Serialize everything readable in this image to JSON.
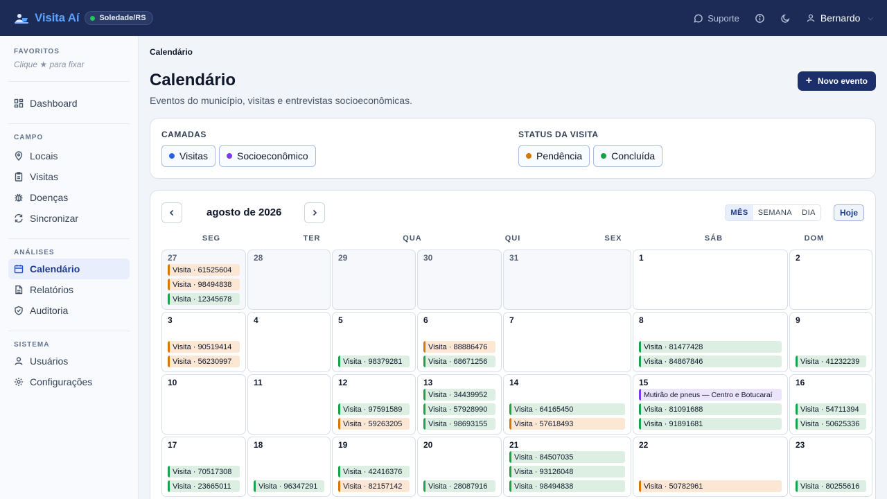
{
  "app": {
    "brand": "Visita Aí",
    "city": "Soledade/RS",
    "support": "Suporte",
    "user": "Bernardo"
  },
  "sidebar": {
    "favorites_title": "FAVORITOS",
    "favorites_hint": "Clique ★ para fixar",
    "dashboard": "Dashboard",
    "field_title": "CAMPO",
    "field_items": [
      "Locais",
      "Visitas",
      "Doenças",
      "Sincronizar"
    ],
    "analysis_title": "ANÁLISES",
    "analysis_items": [
      "Calendário",
      "Relatórios",
      "Auditoria"
    ],
    "system_title": "SISTEMA",
    "system_items": [
      "Usuários",
      "Configurações"
    ]
  },
  "page": {
    "breadcrumb": "Calendário",
    "title": "Calendário",
    "subtitle": "Eventos do município, visitas e entrevistas socioeconômicas.",
    "new_event": "Novo evento"
  },
  "filters": {
    "layers_title": "CAMADAS",
    "layers": [
      "Visitas",
      "Socioeconômico"
    ],
    "status_title": "STATUS DA VISITA",
    "status": [
      "Pendência",
      "Concluída"
    ],
    "colors": {
      "visitas": "#2563eb",
      "socio": "#7c3aed",
      "pendencia": "#d97706",
      "concluida": "#16a34a"
    }
  },
  "calendar": {
    "month": "agosto de 2026",
    "views": [
      "MÊS",
      "SEMANA",
      "DIA"
    ],
    "active_view": "MÊS",
    "today": "Hoje",
    "weekdays": [
      "SEG",
      "TER",
      "QUA",
      "QUI",
      "SEX",
      "SÁB",
      "DOM"
    ],
    "weeks": [
      [
        {
          "day": "27",
          "out": true,
          "events": [
            {
              "t": "Visita · 61525604",
              "s": "pend"
            },
            {
              "t": "Visita · 98494838",
              "s": "pend"
            },
            {
              "t": "Visita · 12345678",
              "s": "ok"
            }
          ]
        },
        {
          "day": "28",
          "out": true,
          "events": []
        },
        {
          "day": "29",
          "out": true,
          "events": []
        },
        {
          "day": "30",
          "out": true,
          "events": []
        },
        {
          "day": "31",
          "out": true,
          "events": []
        },
        {
          "day": "1",
          "events": []
        },
        {
          "day": "2",
          "events": []
        }
      ],
      [
        {
          "day": "3",
          "events": [
            {
              "t": "Visita · 90519414",
              "s": "pend"
            },
            {
              "t": "Visita · 56230997",
              "s": "pend"
            }
          ]
        },
        {
          "day": "4",
          "events": []
        },
        {
          "day": "5",
          "events": [
            {
              "t": "Visita · 98379281",
              "s": "ok"
            }
          ]
        },
        {
          "day": "6",
          "events": [
            {
              "t": "Visita · 88886476",
              "s": "pend"
            },
            {
              "t": "Visita · 68671256",
              "s": "ok"
            }
          ]
        },
        {
          "day": "7",
          "events": []
        },
        {
          "day": "8",
          "events": [
            {
              "t": "Visita · 81477428",
              "s": "ok"
            },
            {
              "t": "Visita · 84867846",
              "s": "ok"
            }
          ]
        },
        {
          "day": "9",
          "events": [
            {
              "t": "Visita · 41232239",
              "s": "ok"
            }
          ]
        }
      ],
      [
        {
          "day": "10",
          "events": []
        },
        {
          "day": "11",
          "events": []
        },
        {
          "day": "12",
          "events": [
            {
              "t": "Visita · 97591589",
              "s": "ok"
            },
            {
              "t": "Visita · 59263205",
              "s": "pend"
            }
          ]
        },
        {
          "day": "13",
          "events": [
            {
              "t": "Visita · 34439952",
              "s": "ok"
            },
            {
              "t": "Visita · 57928990",
              "s": "ok"
            },
            {
              "t": "Visita · 98693155",
              "s": "ok"
            }
          ]
        },
        {
          "day": "14",
          "events": [
            {
              "t": "Visita · 64165450",
              "s": "ok"
            },
            {
              "t": "Visita · 57618493",
              "s": "pend"
            }
          ]
        },
        {
          "day": "15",
          "events": [
            {
              "t": "Mutirão de pneus — Centro e Botucaraí",
              "s": "soc"
            },
            {
              "t": "Visita · 81091688",
              "s": "ok"
            },
            {
              "t": "Visita · 91891681",
              "s": "ok"
            }
          ]
        },
        {
          "day": "16",
          "events": [
            {
              "t": "Visita · 54711394",
              "s": "ok"
            },
            {
              "t": "Visita · 50625336",
              "s": "ok"
            }
          ]
        }
      ],
      [
        {
          "day": "17",
          "events": [
            {
              "t": "Visita · 70517308",
              "s": "ok"
            },
            {
              "t": "Visita · 23665011",
              "s": "ok"
            }
          ]
        },
        {
          "day": "18",
          "events": [
            {
              "t": "Visita · 96347291",
              "s": "ok"
            }
          ]
        },
        {
          "day": "19",
          "events": [
            {
              "t": "Visita · 42416376",
              "s": "ok"
            },
            {
              "t": "Visita · 82157142",
              "s": "pend"
            }
          ]
        },
        {
          "day": "20",
          "events": [
            {
              "t": "Visita · 28087916",
              "s": "ok"
            }
          ]
        },
        {
          "day": "21",
          "events": [
            {
              "t": "Visita · 84507035",
              "s": "ok"
            },
            {
              "t": "Visita · 93126048",
              "s": "ok"
            },
            {
              "t": "Visita · 98494838",
              "s": "ok"
            }
          ]
        },
        {
          "day": "22",
          "events": [
            {
              "t": "Visita · 50782961",
              "s": "pend"
            }
          ]
        },
        {
          "day": "23",
          "events": [
            {
              "t": "Visita · 80255616",
              "s": "ok"
            }
          ]
        }
      ]
    ]
  }
}
